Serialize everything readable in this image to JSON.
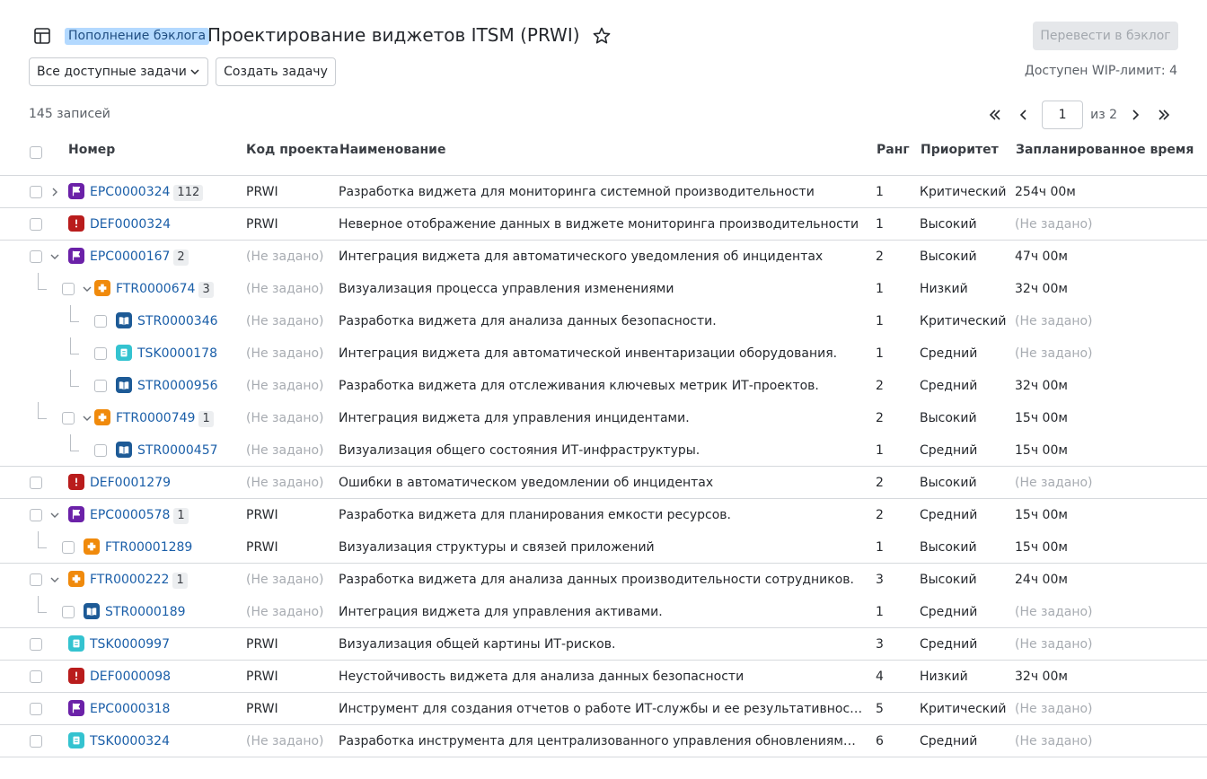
{
  "header": {
    "badge": "Пополнение бэклога",
    "title": "Проектирование виджетов ITSM (PRWI)",
    "move_button": "Перевести в бэклог"
  },
  "toolbar": {
    "filter_value": "Все доступные задачи",
    "create_button": "Создать задачу",
    "wip_limit": "Доступен WIP-лимит: 4"
  },
  "list_info": {
    "records": "145 записей",
    "page": "1",
    "of_pages": "из 2"
  },
  "columns": {
    "number": "Номер",
    "project_code": "Код проекта",
    "name": "Наименование",
    "rank": "Ранг",
    "priority": "Приоритет",
    "planned_time": "Запланированное время"
  },
  "rows": [
    {
      "type": "epic",
      "number": "EPC0000324",
      "count": "112",
      "project": "PRWI",
      "name": "Разработка виджета для мониторинга системной производительности",
      "rank": "1",
      "priority": "Критический",
      "time": "254ч 00м"
    },
    {
      "type": "defect",
      "number": "DEF0000324",
      "count": "",
      "project": "PRWI",
      "name": "Неверное отображение данных в виджете мониторинга производительности",
      "rank": "1",
      "priority": "Высокий",
      "time": "(Не задано)"
    },
    {
      "type": "epic",
      "number": "EPC0000167",
      "count": "2",
      "project": "(Не задано)",
      "name": "Интеграция виджета для автоматического уведомления об инцидентах",
      "rank": "2",
      "priority": "Высокий",
      "time": "47ч 00м"
    },
    {
      "type": "feature",
      "number": "FTR0000674",
      "count": "3",
      "project": "(Не задано)",
      "name": "Визуализация процесса управления изменениями",
      "rank": "1",
      "priority": "Низкий",
      "time": "32ч 00м"
    },
    {
      "type": "story",
      "number": "STR0000346",
      "count": "",
      "project": "(Не задано)",
      "name": "Разработка виджета для анализа данных безопасности.",
      "rank": "1",
      "priority": "Критический",
      "time": "(Не задано)"
    },
    {
      "type": "task",
      "number": "TSK0000178",
      "count": "",
      "project": "(Не задано)",
      "name": "Интеграция виджета для автоматической инвентаризации оборудования.",
      "rank": "1",
      "priority": "Средний",
      "time": "(Не задано)"
    },
    {
      "type": "story",
      "number": "STR0000956",
      "count": "",
      "project": "(Не задано)",
      "name": "Разработка виджета для отслеживания ключевых метрик ИТ-проектов.",
      "rank": "2",
      "priority": "Средний",
      "time": "32ч 00м"
    },
    {
      "type": "feature",
      "number": "FTR0000749",
      "count": "1",
      "project": "(Не задано)",
      "name": "Интеграция виджета для управления инцидентами.",
      "rank": "2",
      "priority": "Высокий",
      "time": "15ч 00м"
    },
    {
      "type": "story",
      "number": "STR0000457",
      "count": "",
      "project": "(Не задано)",
      "name": "Визуализация общего состояния ИТ-инфраструктуры.",
      "rank": "1",
      "priority": "Средний",
      "time": "15ч 00м"
    },
    {
      "type": "defect",
      "number": "DEF0001279",
      "count": "",
      "project": "(Не задано)",
      "name": "Ошибки в автоматическом уведомлении об инцидентах",
      "rank": "2",
      "priority": "Высокий",
      "time": "(Не задано)"
    },
    {
      "type": "epic",
      "number": "EPC0000578",
      "count": "1",
      "project": "PRWI",
      "name": "Разработка виджета для планирования емкости ресурсов.",
      "rank": "2",
      "priority": "Средний",
      "time": "15ч 00м"
    },
    {
      "type": "feature",
      "number": "FTR00001289",
      "count": "",
      "project": "PRWI",
      "name": "Визуализация структуры и связей приложений",
      "rank": "1",
      "priority": "Высокий",
      "time": "15ч 00м"
    },
    {
      "type": "feature",
      "number": "FTR0000222",
      "count": "1",
      "project": "(Не задано)",
      "name": "Разработка виджета для анализа данных производительности сотрудников.",
      "rank": "3",
      "priority": "Высокий",
      "time": "24ч 00м"
    },
    {
      "type": "story",
      "number": "STR0000189",
      "count": "",
      "project": "(Не задано)",
      "name": "Интеграция виджета для управления активами.",
      "rank": "1",
      "priority": "Средний",
      "time": "(Не задано)"
    },
    {
      "type": "task",
      "number": "TSK0000997",
      "count": "",
      "project": "PRWI",
      "name": "Визуализация общей картины ИТ-рисков.",
      "rank": "3",
      "priority": "Средний",
      "time": "(Не задано)"
    },
    {
      "type": "defect",
      "number": "DEF0000098",
      "count": "",
      "project": "PRWI",
      "name": "Неустойчивость виджета для анализа данных безопасности",
      "rank": "4",
      "priority": "Низкий",
      "time": "32ч 00м"
    },
    {
      "type": "epic",
      "number": "EPC0000318",
      "count": "",
      "project": "PRWI",
      "name": "Инструмент для создания отчетов о работе ИТ-службы и ее результативности.",
      "rank": "5",
      "priority": "Критический",
      "time": "(Не задано)"
    },
    {
      "type": "task",
      "number": "TSK0000324",
      "count": "",
      "project": "(Не задано)",
      "name": "Разработка инструмента для централизованного управления обновлениями и пат…",
      "rank": "6",
      "priority": "Средний",
      "time": "(Не задано)"
    }
  ]
}
